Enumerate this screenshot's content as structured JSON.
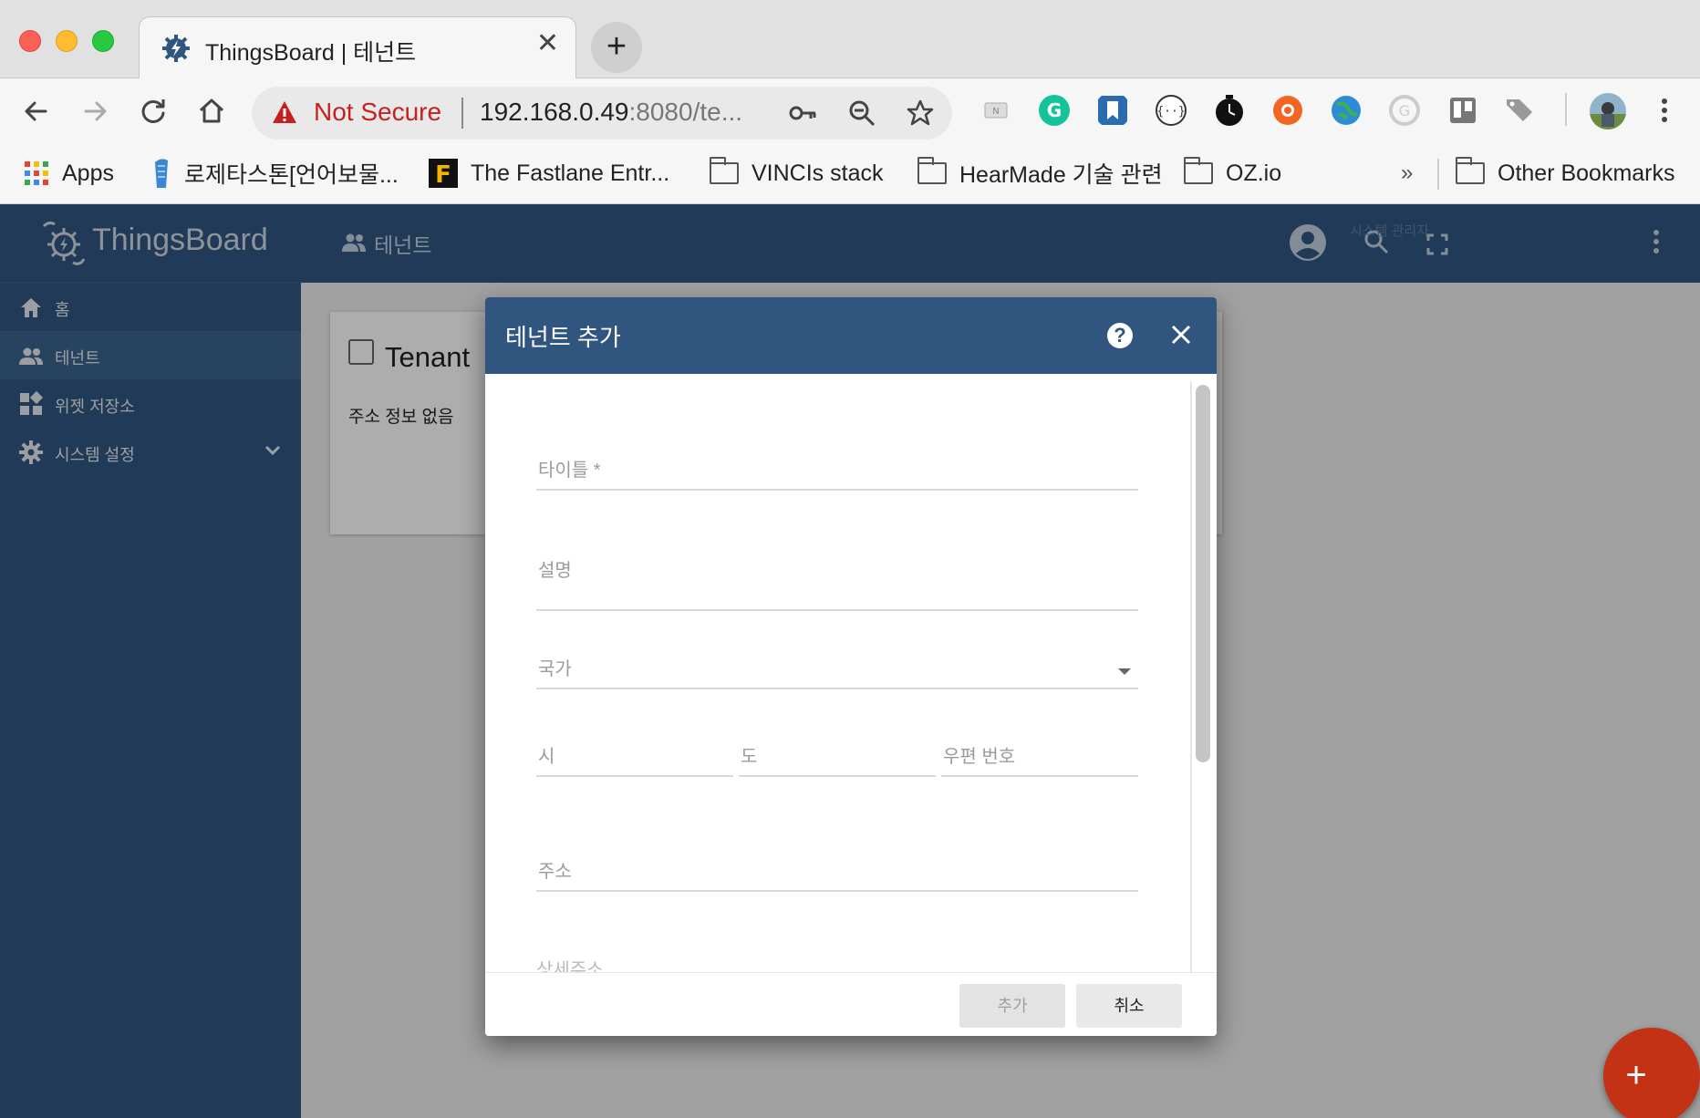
{
  "browser": {
    "tab_title": "ThingsBoard | 테넌트",
    "tab_close": "✕",
    "new_tab": "+",
    "security_label": "Not Secure",
    "url_host": "192.168.0.49",
    "url_rest": ":8080/te...",
    "bookmarks": [
      {
        "label": "Apps",
        "icon": "apps-grid-icon"
      },
      {
        "label": "로제타스톤[언어보물...",
        "icon": "rosetta-icon"
      },
      {
        "label": "The Fastlane Entr...",
        "icon": "fastlane-icon"
      },
      {
        "label": "VINCIs stack",
        "icon": "folder-icon"
      },
      {
        "label": "HearMade 기술 관련",
        "icon": "folder-icon"
      },
      {
        "label": "OZ.io",
        "icon": "folder-icon"
      }
    ],
    "bookmarks_more": "»",
    "other_bookmarks": "Other Bookmarks"
  },
  "app": {
    "logo_text": "ThingsBoard",
    "nav": [
      {
        "label": "홈",
        "icon": "home-icon"
      },
      {
        "label": "테넌트",
        "icon": "people-icon",
        "active": true
      },
      {
        "label": "위젯 저장소",
        "icon": "widgets-icon"
      },
      {
        "label": "시스템 설정",
        "icon": "settings-icon",
        "expandable": true
      }
    ],
    "header_title": "테넌트",
    "header_role": "시스템 관리자",
    "card_title": "Tenant",
    "card_subtitle": "주소 정보 없음",
    "fab_label": "+"
  },
  "dialog": {
    "title": "테넌트 추가",
    "help": "?",
    "fields": {
      "title": "타이틀 *",
      "description": "설명",
      "country": "국가",
      "city": "시",
      "state": "도",
      "zip": "우편 번호",
      "address": "주소",
      "address2_cut": "상세주소"
    },
    "add_button": "추가",
    "cancel_button": "취소"
  },
  "colors": {
    "primary": "#305680",
    "accent": "#c33214",
    "warning": "#c5221f"
  }
}
